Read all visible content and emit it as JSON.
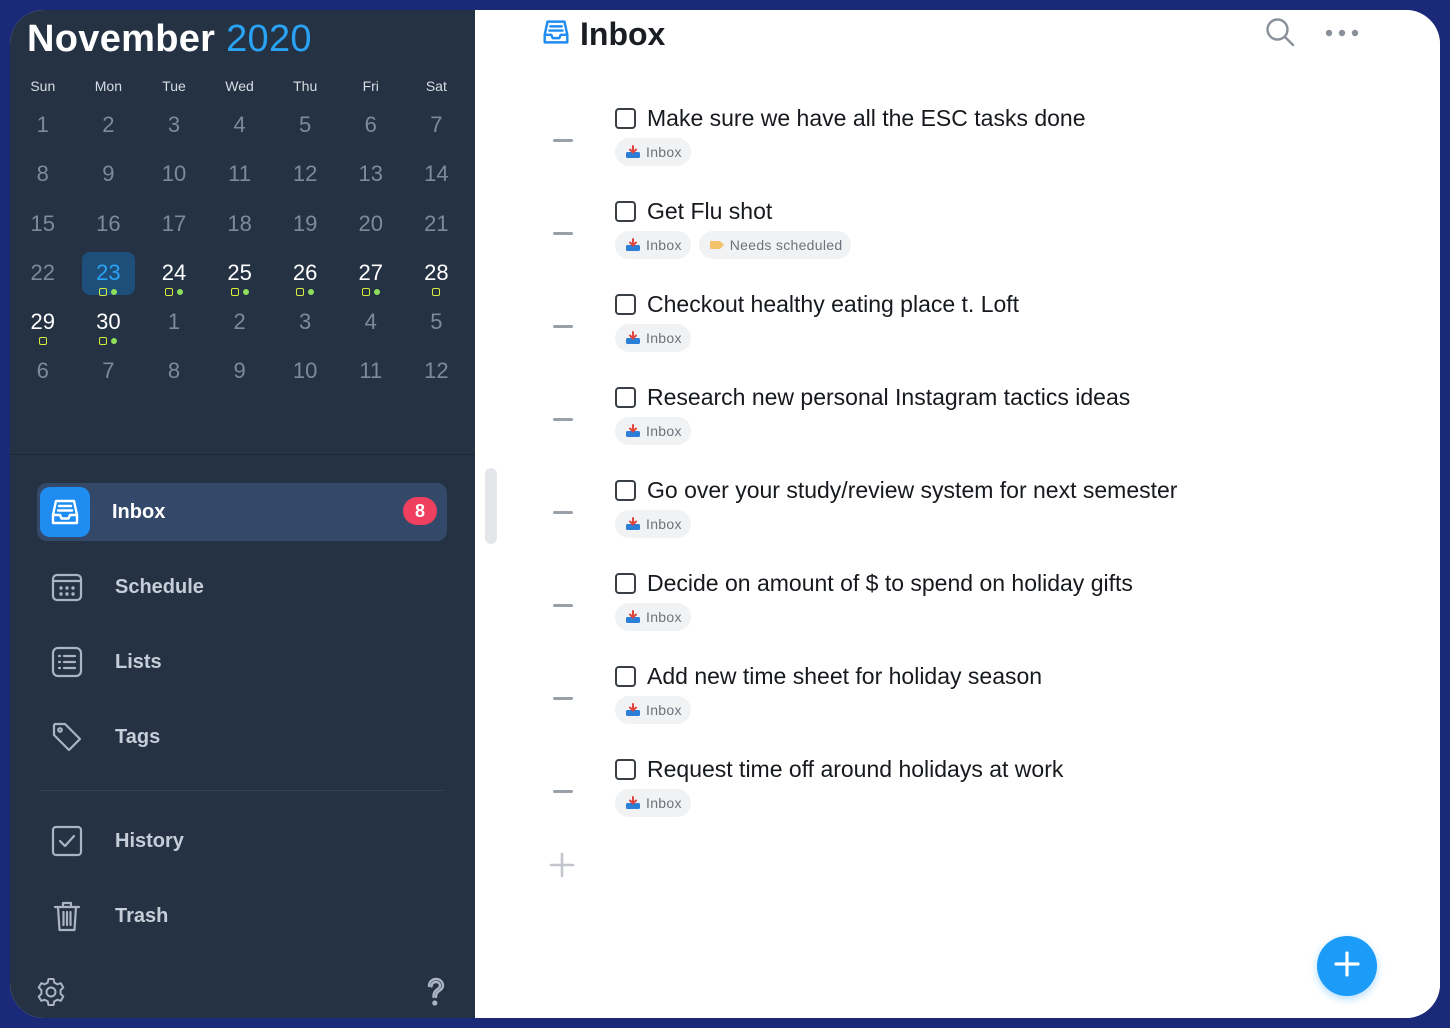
{
  "calendar": {
    "month": "November",
    "year": "2020",
    "weekdays": [
      "Sun",
      "Mon",
      "Tue",
      "Wed",
      "Thu",
      "Fri",
      "Sat"
    ],
    "weeks": [
      [
        {
          "d": "1",
          "s": "past"
        },
        {
          "d": "2",
          "s": "past"
        },
        {
          "d": "3",
          "s": "past"
        },
        {
          "d": "4",
          "s": "past"
        },
        {
          "d": "5",
          "s": "past"
        },
        {
          "d": "6",
          "s": "past"
        },
        {
          "d": "7",
          "s": "past"
        }
      ],
      [
        {
          "d": "8",
          "s": "past"
        },
        {
          "d": "9",
          "s": "past"
        },
        {
          "d": "10",
          "s": "past"
        },
        {
          "d": "11",
          "s": "past"
        },
        {
          "d": "12",
          "s": "past"
        },
        {
          "d": "13",
          "s": "past"
        },
        {
          "d": "14",
          "s": "past"
        }
      ],
      [
        {
          "d": "15",
          "s": "past"
        },
        {
          "d": "16",
          "s": "past"
        },
        {
          "d": "17",
          "s": "past"
        },
        {
          "d": "18",
          "s": "past"
        },
        {
          "d": "19",
          "s": "past"
        },
        {
          "d": "20",
          "s": "past"
        },
        {
          "d": "21",
          "s": "past"
        }
      ],
      [
        {
          "d": "22",
          "s": "past"
        },
        {
          "d": "23",
          "s": "today",
          "dots": "sq-c"
        },
        {
          "d": "24",
          "s": "current",
          "dots": "sq-c"
        },
        {
          "d": "25",
          "s": "current",
          "dots": "sq-c"
        },
        {
          "d": "26",
          "s": "current",
          "dots": "sq-c"
        },
        {
          "d": "27",
          "s": "current",
          "dots": "sq-c"
        },
        {
          "d": "28",
          "s": "current",
          "dots": "sq"
        }
      ],
      [
        {
          "d": "29",
          "s": "current",
          "dots": "sq"
        },
        {
          "d": "30",
          "s": "current",
          "dots": "sq-c"
        },
        {
          "d": "1",
          "s": "next"
        },
        {
          "d": "2",
          "s": "next"
        },
        {
          "d": "3",
          "s": "next"
        },
        {
          "d": "4",
          "s": "next"
        },
        {
          "d": "5",
          "s": "next"
        }
      ],
      [
        {
          "d": "6",
          "s": "next"
        },
        {
          "d": "7",
          "s": "next"
        },
        {
          "d": "8",
          "s": "next"
        },
        {
          "d": "9",
          "s": "next"
        },
        {
          "d": "10",
          "s": "next"
        },
        {
          "d": "11",
          "s": "next"
        },
        {
          "d": "12",
          "s": "next"
        }
      ]
    ]
  },
  "sidebar": {
    "nav": [
      {
        "label": "Inbox",
        "icon": "inbox-icon",
        "active": true,
        "badge": "8"
      },
      {
        "label": "Schedule",
        "icon": "calendar-icon"
      },
      {
        "label": "Lists",
        "icon": "list-icon"
      },
      {
        "label": "Tags",
        "icon": "tag-icon"
      }
    ],
    "nav2": [
      {
        "label": "History",
        "icon": "checkbox-icon"
      },
      {
        "label": "Trash",
        "icon": "trash-icon"
      }
    ]
  },
  "header": {
    "title": "Inbox"
  },
  "tasks": [
    {
      "title": "Make sure we have all the ESC tasks done",
      "tags": [
        "Inbox"
      ]
    },
    {
      "title": "Get Flu shot",
      "tags": [
        "Inbox",
        "Needs scheduled"
      ]
    },
    {
      "title": "Checkout healthy eating place t. Loft",
      "tags": [
        "Inbox"
      ]
    },
    {
      "title": "Research new personal Instagram tactics ideas",
      "tags": [
        "Inbox"
      ]
    },
    {
      "title": "Go over your study/review system for next semester",
      "tags": [
        "Inbox"
      ]
    },
    {
      "title": "Decide on amount of $ to spend on holiday gifts",
      "tags": [
        "Inbox"
      ]
    },
    {
      "title": "Add new time sheet for holiday season",
      "tags": [
        "Inbox"
      ]
    },
    {
      "title": "Request time off around holidays at work",
      "tags": [
        "Inbox"
      ]
    }
  ],
  "colors": {
    "accent": "#1a9cf8",
    "sidebar_bg": "#243244",
    "badge": "#f04060",
    "event_square": "#d6ee3a",
    "event_dot": "#8ee05a"
  }
}
